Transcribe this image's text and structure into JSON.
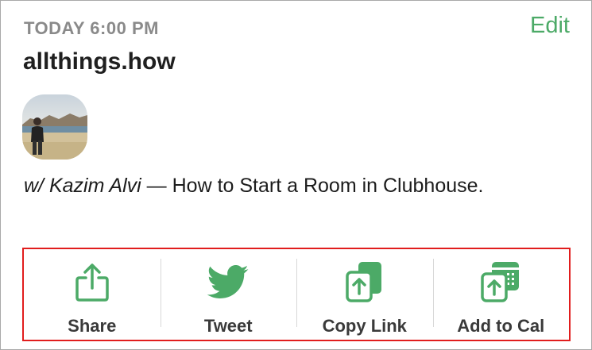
{
  "event": {
    "time": "TODAY 6:00 PM",
    "edit_label": "Edit",
    "club_name": "allthings.how",
    "guest_prefix": "w/ Kazim Alvi",
    "separator": " — ",
    "title": "How to Start a Room in Clubhouse."
  },
  "actions": [
    {
      "label": "Share",
      "icon": "share-icon"
    },
    {
      "label": "Tweet",
      "icon": "twitter-icon"
    },
    {
      "label": "Copy Link",
      "icon": "copy-link-icon"
    },
    {
      "label": "Add to Cal",
      "icon": "add-to-calendar-icon"
    }
  ],
  "colors": {
    "accent_green": "#4caa67",
    "highlight_red": "#e11d1d",
    "muted_gray": "#8a8a8a"
  }
}
